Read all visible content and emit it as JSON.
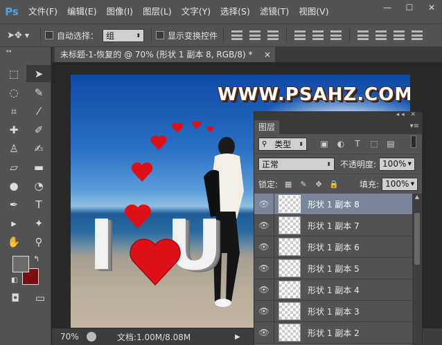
{
  "app": {
    "logo": "Ps",
    "menu": [
      "文件(F)",
      "编辑(E)",
      "图像(I)",
      "图层(L)",
      "文字(Y)",
      "选择(S)",
      "滤镜(T)",
      "视图(V)"
    ],
    "window_controls": [
      "—",
      "☐",
      "✕"
    ]
  },
  "options": {
    "auto_select_label": "自动选择：",
    "auto_select_value": "组",
    "show_transform_label": "显示变换控件"
  },
  "document": {
    "tab_title": "未标题-1-恢复的 @ 70% (形状 1 副本 8, RGB/8) *",
    "tab_close": "×",
    "watermark": "WWW.PSAHZ.COM",
    "letter_left": "I",
    "letter_right": "U"
  },
  "status": {
    "zoom": "70%",
    "doc_info": "文档:1.00M/8.08M"
  },
  "colors": {
    "foreground": "#6b6b6b",
    "background": "#7a0d12",
    "heart": "#e01018",
    "selected_layer": "#7b8599"
  },
  "layers_panel": {
    "tab_label": "图层",
    "filter_value": "类型",
    "blend_mode": "正常",
    "opacity_label": "不透明度:",
    "opacity_value": "100%",
    "lock_label": "锁定:",
    "fill_label": "填充:",
    "fill_value": "100%",
    "layers": [
      {
        "name": "形状 1 副本 8",
        "selected": true
      },
      {
        "name": "形状 1 副本 7",
        "selected": false
      },
      {
        "name": "形状 1 副本 6",
        "selected": false
      },
      {
        "name": "形状 1 副本 5",
        "selected": false
      },
      {
        "name": "形状 1 副本 4",
        "selected": false
      },
      {
        "name": "形状 1 副本 3",
        "selected": false
      },
      {
        "name": "形状 1 副本 2",
        "selected": false
      }
    ]
  }
}
